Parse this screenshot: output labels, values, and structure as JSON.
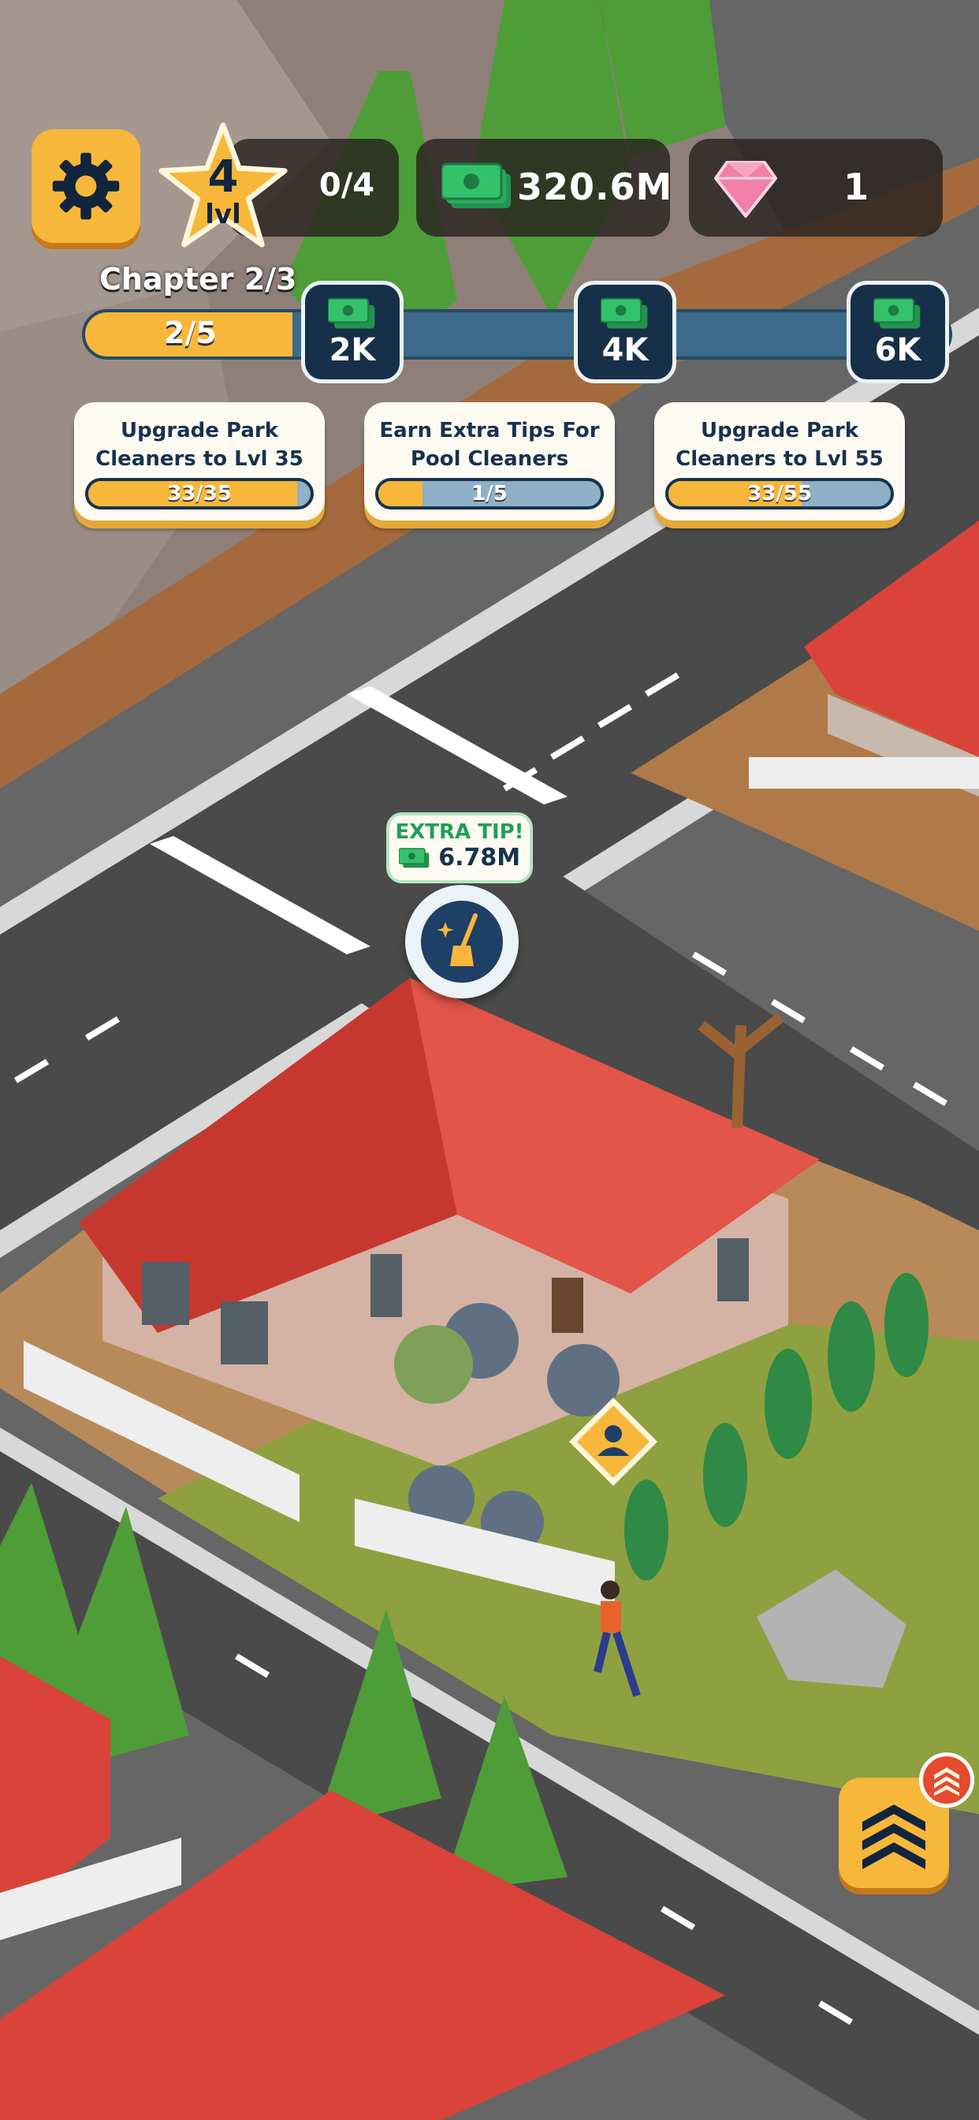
{
  "hud": {
    "level": {
      "number": "4",
      "unit": "lvl",
      "xp": "0/4"
    },
    "cash": "320.6M",
    "gems": "1"
  },
  "chapter": {
    "label": "Chapter 2/3",
    "progress_text": "2/5",
    "progress_fraction": 0.4,
    "rewards": [
      "2K",
      "4K",
      "6K"
    ]
  },
  "quests": [
    {
      "title": "Upgrade Park Cleaners to Lvl 35",
      "progress": "33/35",
      "fraction": 0.94
    },
    {
      "title": "Earn Extra Tips For Pool Cleaners",
      "progress": "1/5",
      "fraction": 0.2
    },
    {
      "title": "Upgrade Park Cleaners to Lvl 55",
      "progress": "33/55",
      "fraction": 0.6
    }
  ],
  "extra_tip": {
    "title": "EXTRA TIP!",
    "amount": "6.78M"
  },
  "icons": {
    "settings": "gear-icon",
    "level": "star-icon",
    "cash": "cash-stack-icon",
    "gems": "gem-icon",
    "clean": "broom-bucket-icon",
    "worker": "person-icon",
    "upgrade": "chevrons-up-icon",
    "notification": "chevrons-up-icon"
  },
  "colors": {
    "accent": "#f7b73a",
    "navy": "#17324e",
    "bar_blue": "#3b6a8a",
    "cash_green": "#33c26a",
    "gem_pink": "#f080a8",
    "roof_red": "#d9433a"
  }
}
